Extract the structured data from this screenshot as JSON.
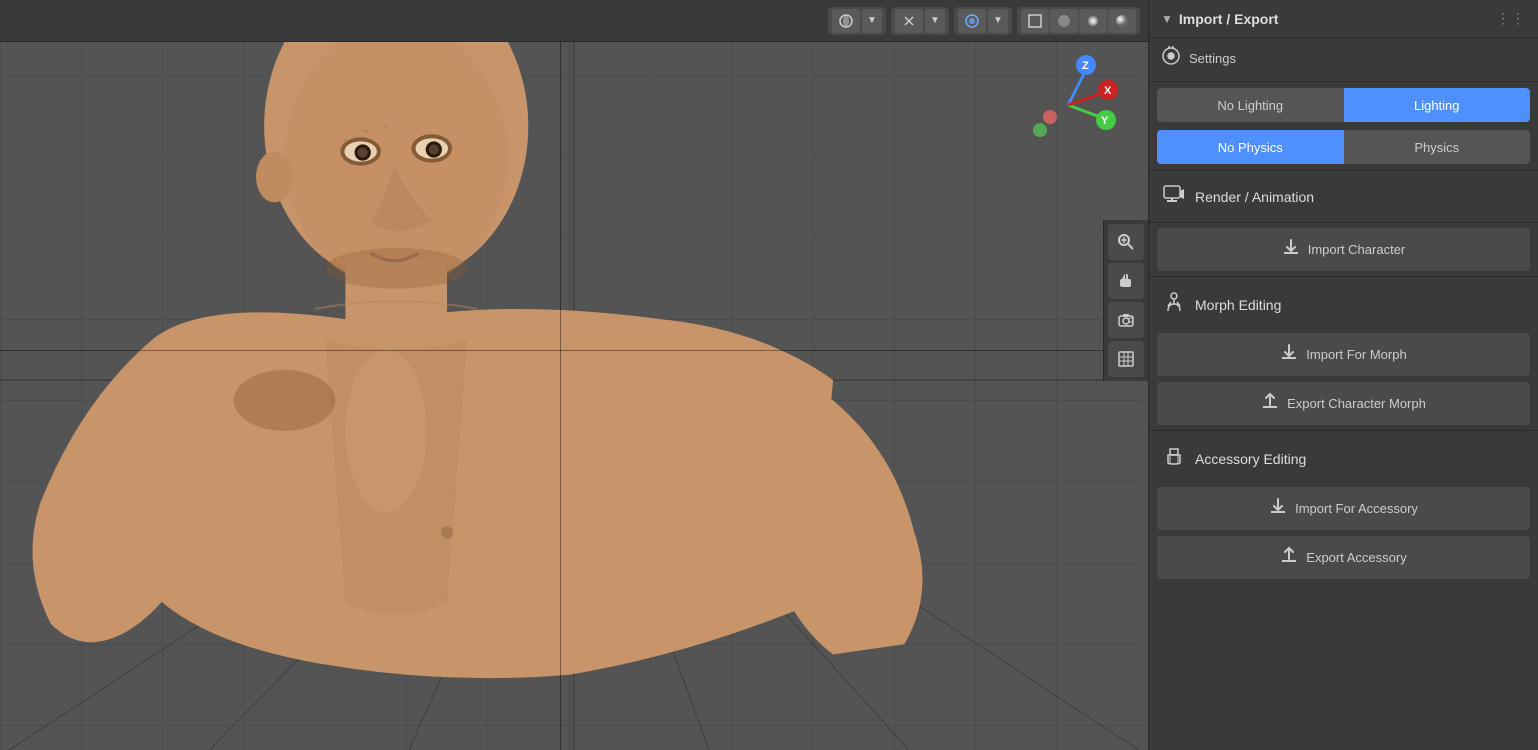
{
  "panel": {
    "title": "Import / Export",
    "collapse_char": "▼",
    "dots": "⋮⋮"
  },
  "settings": {
    "label": "Settings",
    "icon": "⚙"
  },
  "lighting_toggle": {
    "no_lighting": "No Lighting",
    "lighting": "Lighting",
    "active": "lighting"
  },
  "physics_toggle": {
    "no_physics": "No Physics",
    "physics": "Physics",
    "active": "no_physics"
  },
  "render_animation": {
    "label": "Render / Animation"
  },
  "import_character": {
    "label": "Import Character"
  },
  "morph_editing": {
    "label": "Morph Editing"
  },
  "import_for_morph": {
    "label": "Import For Morph"
  },
  "export_character_morph": {
    "label": "Export Character Morph"
  },
  "accessory_editing": {
    "label": "Accessory Editing"
  },
  "import_for_accessory": {
    "label": "Import For Accessory"
  },
  "export_accessory": {
    "label": "Export Accessory"
  },
  "toolbar": {
    "view_icon": "👁",
    "snap_icon": "✕",
    "overlay_icon": "⊕",
    "viewport_shade_icon": "◐"
  },
  "side_tools": [
    {
      "name": "zoom-tool",
      "icon": "🔍"
    },
    {
      "name": "grab-tool",
      "icon": "✋"
    },
    {
      "name": "camera-tool",
      "icon": "🎥"
    },
    {
      "name": "grid-tool",
      "icon": "⊞"
    }
  ]
}
